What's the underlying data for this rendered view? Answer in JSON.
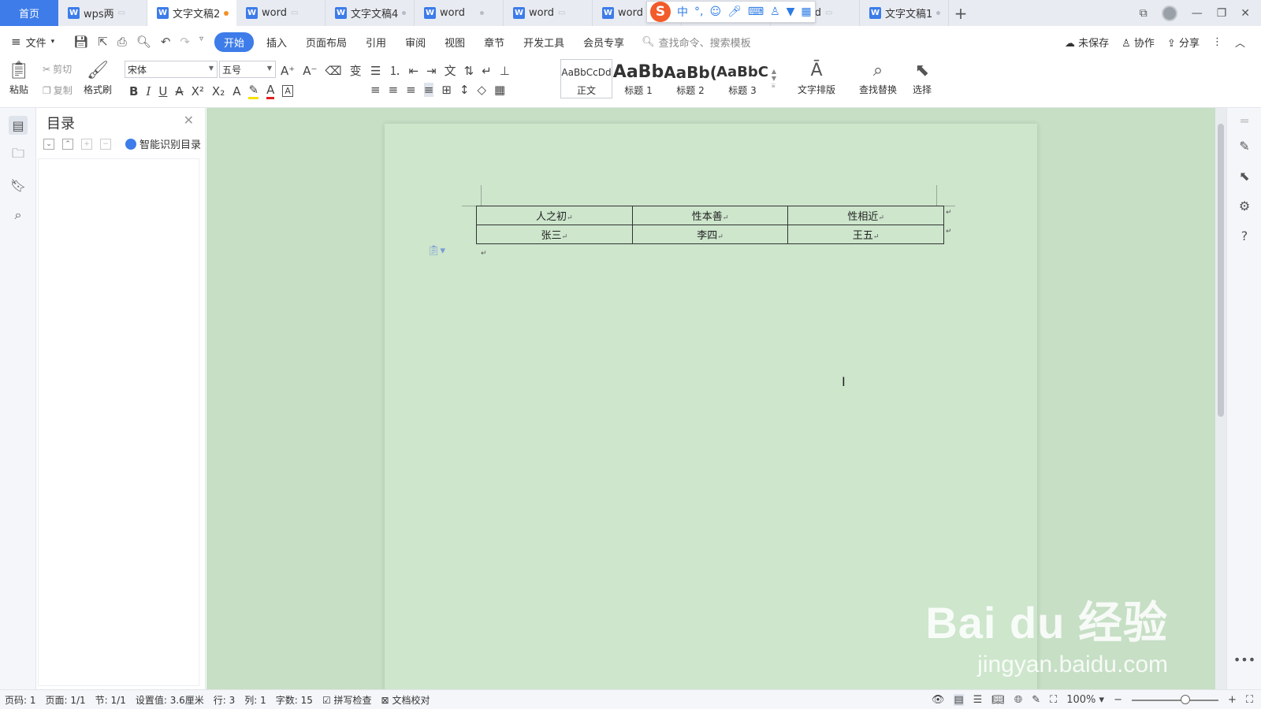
{
  "tabs": {
    "home": "首页",
    "docs": [
      {
        "label": "wps两",
        "state": "cloud"
      },
      {
        "label": "文字文稿2",
        "state": "modified"
      },
      {
        "label": "word",
        "state": "cloud"
      },
      {
        "label": "文字文稿4",
        "state": "dot"
      },
      {
        "label": "word",
        "state": "dot"
      },
      {
        "label": "word",
        "state": "cloud"
      },
      {
        "label": "word",
        "state": "none"
      },
      {
        "label": "ord",
        "state": "cloud"
      },
      {
        "label": "word",
        "state": "cloud"
      },
      {
        "label": "文字文稿1",
        "state": "dot"
      }
    ],
    "add": "+"
  },
  "ime": {
    "logo": "S",
    "mode": "中"
  },
  "menu": {
    "file": "文件",
    "items": [
      "开始",
      "插入",
      "页面布局",
      "引用",
      "审阅",
      "视图",
      "章节",
      "开发工具",
      "会员专享"
    ],
    "search_placeholder": "查找命令、搜索模板",
    "unsaved": "未保存",
    "collab": "协作",
    "share": "分享"
  },
  "ribbon": {
    "paste": "粘贴",
    "cut": "剪切",
    "copy": "复制",
    "format_painter": "格式刷",
    "font_name": "宋体",
    "font_size": "五号",
    "styles": [
      {
        "sample": "AaBbCcDd",
        "label": "正文"
      },
      {
        "sample": "AaBb",
        "label": "标题 1"
      },
      {
        "sample": "AaBb(",
        "label": "标题 2"
      },
      {
        "sample": "AaBbC",
        "label": "标题 3"
      }
    ],
    "text_layout": "文字排版",
    "find_replace": "查找替换",
    "select": "选择"
  },
  "toc": {
    "title": "目录",
    "smart": "智能识别目录"
  },
  "document": {
    "table": [
      [
        "人之初",
        "性本善",
        "性相近"
      ],
      [
        "张三",
        "李四",
        "王五"
      ]
    ]
  },
  "watermark": {
    "main": "Bai du 经验",
    "sub": "jingyan.baidu.com"
  },
  "status": {
    "page_num": "页码: 1",
    "pages": "页面: 1/1",
    "section": "节: 1/1",
    "setting": "设置值: 3.6厘米",
    "row": "行: 3",
    "col": "列: 1",
    "words": "字数: 15",
    "spell": "拼写检查",
    "proof": "文档校对",
    "zoom": "100%"
  },
  "zoom_level": 0.62,
  "colors": {
    "accent": "#3d7ce9",
    "page": "#cde6cc",
    "workspace": "#c6dfc5"
  }
}
